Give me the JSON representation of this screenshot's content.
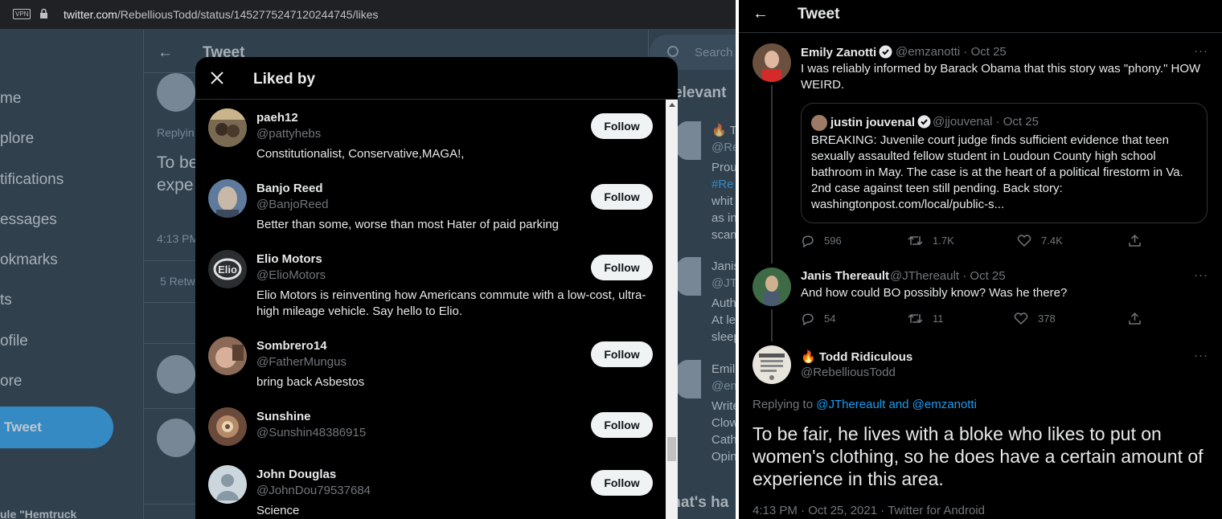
{
  "browser": {
    "vpn_label": "VPN",
    "url_host": "twitter.com",
    "url_path": "/RebelliousTodd/status/1452775247120244745/likes"
  },
  "background": {
    "nav_items": [
      "me",
      "plore",
      "tifications",
      "essages",
      "okmarks",
      "ts",
      "ofile",
      "ore"
    ],
    "tweet_button": "Tweet",
    "bottom_text": "ule \"Hemtruck",
    "center_title": "Tweet",
    "center_replying": "Replyin",
    "center_big_text": "To be wom expe",
    "center_time": "4:13 PM",
    "center_retweets": "5 Retw",
    "search_placeholder": "Search",
    "relevant_heading": "elevant",
    "whats_heading": "/hat's ha",
    "right_lines": [
      {
        "text": "🔥 T",
        "style": ""
      },
      {
        "text": "@Re",
        "style": "grey"
      },
      {
        "text": "Prou",
        "style": ""
      },
      {
        "text": "#Re",
        "style": "blue"
      },
      {
        "text": "whit",
        "style": ""
      },
      {
        "text": "as in",
        "style": ""
      },
      {
        "text": "scam",
        "style": ""
      },
      {
        "text": "Janis",
        "style": ""
      },
      {
        "text": "@JT",
        "style": "grey"
      },
      {
        "text": "Auth",
        "style": ""
      },
      {
        "text": "At le",
        "style": ""
      },
      {
        "text": "sleep",
        "style": ""
      },
      {
        "text": "Emil",
        "style": ""
      },
      {
        "text": "@em",
        "style": "grey"
      },
      {
        "text": "Write",
        "style": ""
      },
      {
        "text": "Clow",
        "style": ""
      },
      {
        "text": "Cath",
        "style": ""
      },
      {
        "text": "Opin",
        "style": ""
      }
    ]
  },
  "modal": {
    "title": "Liked by",
    "follow_label": "Follow",
    "users": [
      {
        "name": "paeh12",
        "handle": "@pattyhebs",
        "bio": "Constitutionalist, Conservative,MAGA!,"
      },
      {
        "name": "Banjo Reed",
        "handle": "@BanjoReed",
        "bio": "Better than some, worse than most Hater of paid parking"
      },
      {
        "name": "Elio Motors",
        "handle": "@ElioMotors",
        "bio": "Elio Motors is reinventing how Americans commute with a low-cost, ultra-high mileage vehicle. Say hello to Elio."
      },
      {
        "name": "Sombrero14",
        "handle": "@FatherMungus",
        "bio": "bring back Asbestos"
      },
      {
        "name": "Sunshine",
        "handle": "@Sunshin48386915",
        "bio": ""
      },
      {
        "name": "John Douglas",
        "handle": "@JohnDou79537684",
        "bio": "Science"
      }
    ]
  },
  "right_panel": {
    "title": "Tweet",
    "tweet1": {
      "name": "Emily Zanotti",
      "meta": "@emzanotti · Oct 25",
      "text": "I was reliably informed by Barack Obama that this story was \"phony.\" HOW WEIRD.",
      "quote": {
        "name": "justin jouvenal",
        "meta": "@jjouvenal · Oct 25",
        "text": "BREAKING: Juvenile court judge finds sufficient evidence that teen sexually assaulted fellow student in Loudoun County high school bathroom in May. The case is at the heart of a political firestorm in Va. 2nd case against teen still pending. Back story: washingtonpost.com/local/public-s..."
      },
      "replies": "596",
      "retweets": "1.7K",
      "likes": "7.4K"
    },
    "tweet2": {
      "name": "Janis Thereault",
      "meta": "@JThereault · Oct 25",
      "text": "And how could BO possibly know? Was he there?",
      "replies": "54",
      "retweets": "11",
      "likes": "378"
    },
    "main_tweet": {
      "name": "🔥 Todd Ridiculous",
      "handle": "@RebelliousTodd",
      "replying_prefix": "Replying to ",
      "replying_to": "@JThereault and @emzanotti",
      "text": "To be fair, he lives with a bloke who likes to put on women's clothing, so he does have a certain amount of experience in this area.",
      "timestamp": "4:13 PM · Oct 25, 2021 · Twitter for Android"
    },
    "more_label": "···"
  },
  "colors": {
    "twitter_blue": "#1d9bf0",
    "dim_bg": "#15202b",
    "black_bg": "#000000",
    "follow_bg": "#eff3f4"
  }
}
